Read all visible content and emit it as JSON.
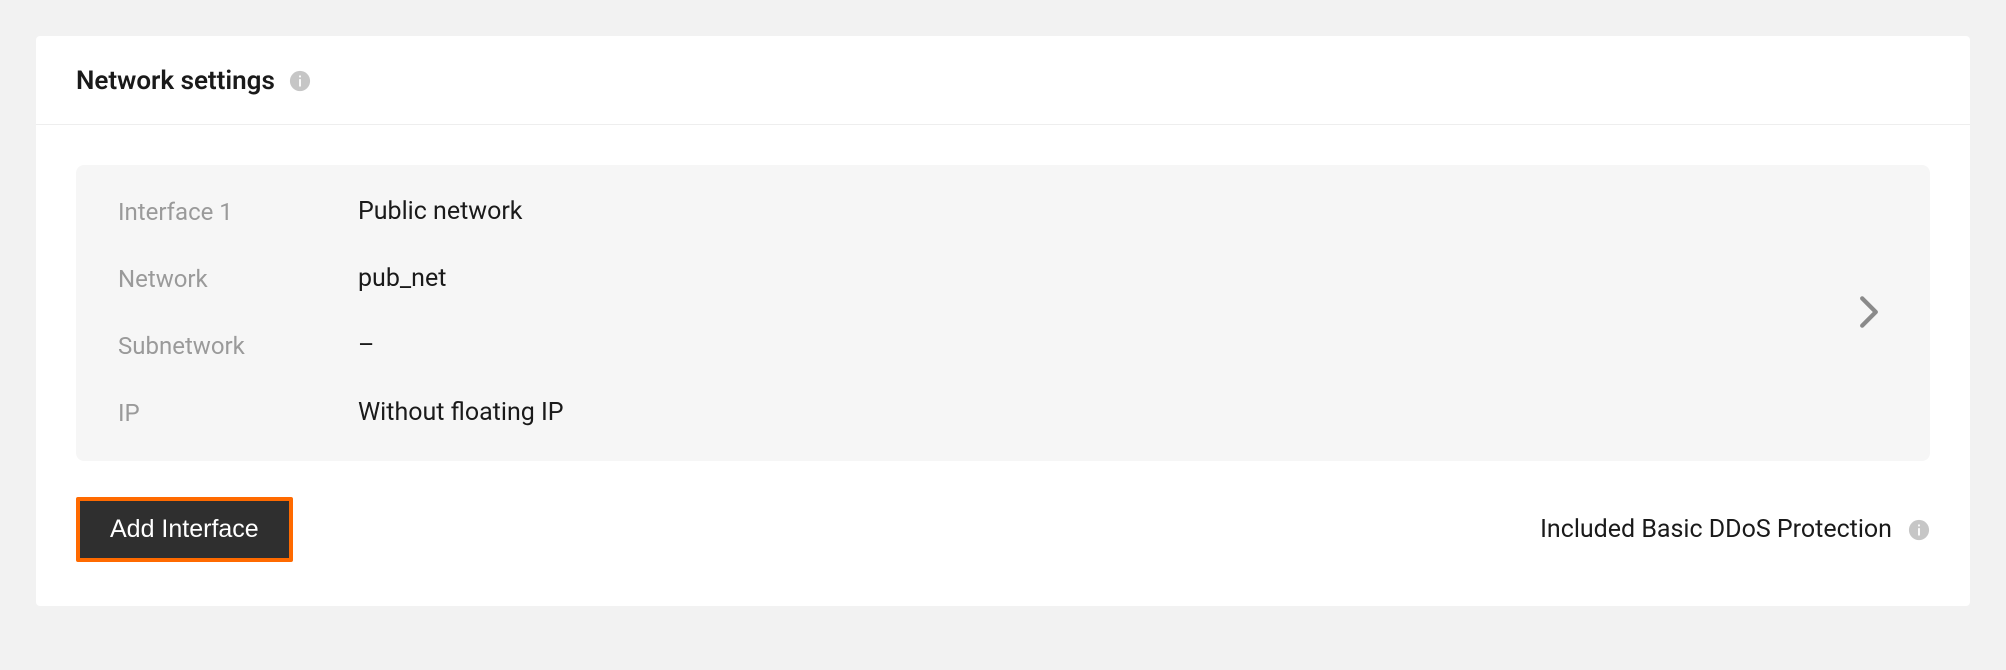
{
  "section": {
    "title": "Network settings"
  },
  "interface": {
    "label_title": "Interface 1",
    "title_value": "Public network",
    "label_network": "Network",
    "network_value": "pub_net",
    "label_subnetwork": "Subnetwork",
    "subnetwork_value": "–",
    "label_ip": "IP",
    "ip_value": "Without floating IP"
  },
  "actions": {
    "add_interface_label": "Add Interface",
    "ddos_text": "Included Basic DDoS Protection"
  }
}
